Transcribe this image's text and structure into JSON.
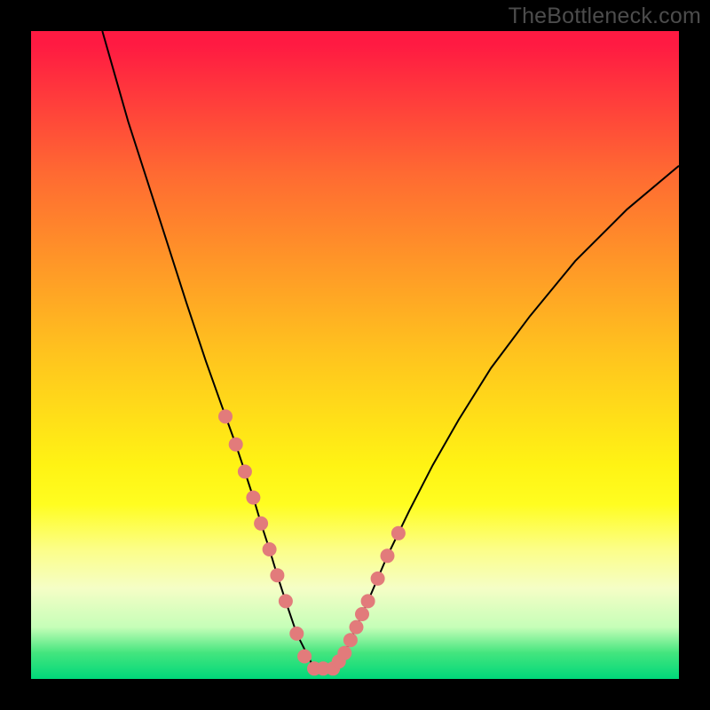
{
  "watermark": "TheBottleneck.com",
  "chart_data": {
    "type": "line",
    "title": "",
    "xlabel": "",
    "ylabel": "",
    "xlim": [
      0,
      100
    ],
    "ylim": [
      0,
      100
    ],
    "series": [
      {
        "name": "curve",
        "x": [
          11,
          15,
          20,
          24,
          27,
          29.5,
          31.5,
          33,
          34.3,
          35.5,
          36.8,
          38,
          39.3,
          41,
          43.7,
          46.6,
          48.4,
          52,
          55,
          58.4,
          62,
          66,
          71,
          77,
          84,
          92,
          100
        ],
        "values": [
          100,
          86,
          70.5,
          58,
          49,
          42,
          36.5,
          32,
          28,
          24,
          20,
          16,
          12,
          7,
          1.6,
          1.6,
          4,
          12,
          19,
          26,
          33,
          40,
          48,
          56,
          64.5,
          72.5,
          79.2
        ]
      }
    ],
    "markers": {
      "comment": "pink circular markers along lower portion of the V",
      "x": [
        30,
        31.6,
        33,
        34.3,
        35.5,
        36.8,
        38,
        39.3,
        41,
        42.2,
        43.7,
        45.1,
        46.6,
        47.5,
        48.4,
        49.3,
        50.2,
        51.1,
        52,
        53.5,
        55,
        56.7
      ],
      "values": [
        40.5,
        36.2,
        32,
        28,
        24,
        20,
        16,
        12,
        7,
        3.5,
        1.6,
        1.6,
        1.6,
        2.7,
        4,
        6,
        8,
        10,
        12,
        15.5,
        19,
        22.5
      ]
    },
    "background_gradient": {
      "stops": [
        {
          "pos": 0.0,
          "color": "#ff1a42"
        },
        {
          "pos": 0.1,
          "color": "#ff3a3c"
        },
        {
          "pos": 0.22,
          "color": "#ff6a32"
        },
        {
          "pos": 0.35,
          "color": "#ff9428"
        },
        {
          "pos": 0.5,
          "color": "#ffc41e"
        },
        {
          "pos": 0.67,
          "color": "#fff314"
        },
        {
          "pos": 0.73,
          "color": "#fffd20"
        },
        {
          "pos": 0.8,
          "color": "#fcfe88"
        },
        {
          "pos": 0.86,
          "color": "#f5fec6"
        },
        {
          "pos": 0.92,
          "color": "#c6feb8"
        },
        {
          "pos": 0.96,
          "color": "#43e57e"
        },
        {
          "pos": 1.0,
          "color": "#00d87a"
        }
      ]
    },
    "colors": {
      "curve": "#000000",
      "marker_fill": "#e27b7b",
      "marker_stroke": "#c96262",
      "frame_bg": "#000000"
    }
  }
}
